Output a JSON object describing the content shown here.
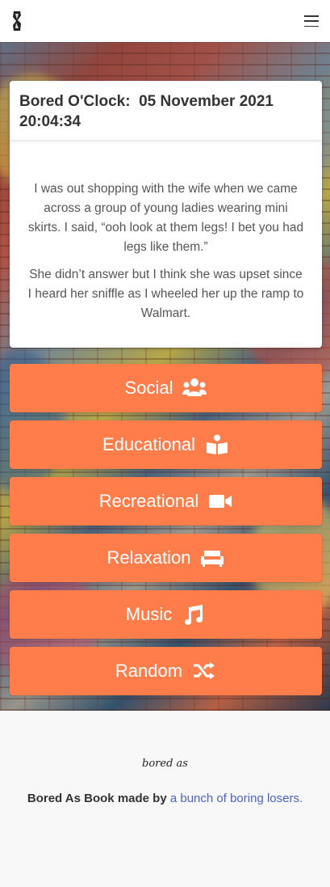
{
  "nav": {
    "logo_icon": "brand-logo-icon",
    "menu_icon": "hamburger-menu-icon"
  },
  "card": {
    "title_prefix": "Bored O'Clock:",
    "title_date": "05 November 2021",
    "title_time": "20:04:34",
    "paragraphs": [
      "I was out shopping with the wife when we came across a group of young ladies wearing mini skirts. I said, “ooh look at them legs! I bet you had legs like them.”",
      "She didn’t answer but I think she was upset since I heard her sniffle as I wheeled her up the ramp to Walmart."
    ]
  },
  "categories": [
    {
      "label": "Social",
      "icon": "users-icon"
    },
    {
      "label": "Educational",
      "icon": "book-reader-icon"
    },
    {
      "label": "Recreational",
      "icon": "video-camera-icon"
    },
    {
      "label": "Relaxation",
      "icon": "couch-icon"
    },
    {
      "label": "Music",
      "icon": "music-note-icon"
    },
    {
      "label": "Random",
      "icon": "shuffle-icon"
    }
  ],
  "footer": {
    "logo_text": "bored as",
    "credit_bold": "Bored As Book made by",
    "credit_link": "a bunch of boring losers."
  },
  "colors": {
    "accent": "#ff7d4a",
    "link": "#4a62c8"
  }
}
